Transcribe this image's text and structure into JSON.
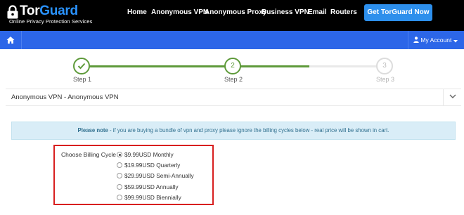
{
  "header": {
    "logo": {
      "title_main": "Tor",
      "title_accent": "Guard",
      "tagline": "Online Privacy Protection Services"
    },
    "nav": [
      "Home",
      "Anonymous VPN",
      "Anonymous Proxy",
      "Business VPN",
      "Email",
      "Routers"
    ],
    "cta_label": "Get TorGuard Now"
  },
  "toolbar": {
    "home_icon": "home-icon",
    "account_label": "My Account",
    "account_icon": "user-icon"
  },
  "steps": [
    {
      "label": "Step 1",
      "number": "1",
      "state": "complete"
    },
    {
      "label": "Step 2",
      "number": "2",
      "state": "current"
    },
    {
      "label": "Step 3",
      "number": "3",
      "state": "pending"
    }
  ],
  "product": {
    "title": "Anonymous VPN - Anonymous VPN"
  },
  "note": {
    "strong": "Please note",
    "text": " - if you are buying a bundle of vpn and proxy please ignore the billing cycles below - real price will be shown in cart."
  },
  "billing": {
    "label": "Choose Billing Cycle",
    "selected_index": 0,
    "options": [
      "$9.99USD Monthly",
      "$19.99USD Quarterly",
      "$29.99USD Semi-Annually",
      "$59.99USD Annually",
      "$99.99USD Biennially"
    ]
  },
  "colors": {
    "header_bg": "#000000",
    "brand_blue": "#2c66e8",
    "cta_blue": "#2d8fec",
    "progress_green": "#5e9a3a",
    "note_bg": "#d9edf7",
    "highlight_red": "#d81f1f"
  }
}
